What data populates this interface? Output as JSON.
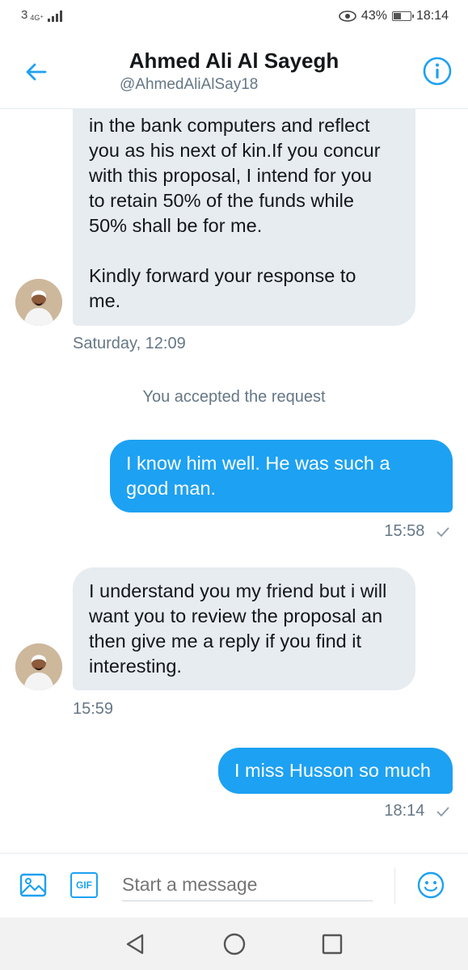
{
  "status_bar": {
    "network": "3",
    "network_type": "4G⁺",
    "battery_percent": "43%",
    "time": "18:14"
  },
  "header": {
    "name": "Ahmed Ali Al Sayegh",
    "handle": "@AhmedAliAlSay18"
  },
  "messages": [
    {
      "lines": [
        "in the bank computers and reflect",
        "you as his next of kin.If you concur",
        "with this proposal, I intend for you",
        "to retain 50% of the funds while",
        "50% shall be for me.",
        "",
        "Kindly forward your response to",
        "me."
      ],
      "timestamp": "Saturday, 12:09"
    },
    {
      "system": "You accepted the request"
    },
    {
      "lines": [
        "I know him well. He was such a",
        "good man."
      ],
      "timestamp": "15:58"
    },
    {
      "lines": [
        "I understand you my friend but i will",
        "want you to review the proposal an",
        "then give me a reply if you find it",
        "interesting."
      ],
      "timestamp": "15:59"
    },
    {
      "lines": [
        "I miss Husson so much"
      ],
      "timestamp": "18:14"
    }
  ],
  "composer": {
    "placeholder": "Start a message",
    "gif_label": "GIF"
  },
  "colors": {
    "accent": "#1da1f2",
    "incoming_bubble": "#e6ecf0",
    "muted_text": "#657786"
  }
}
